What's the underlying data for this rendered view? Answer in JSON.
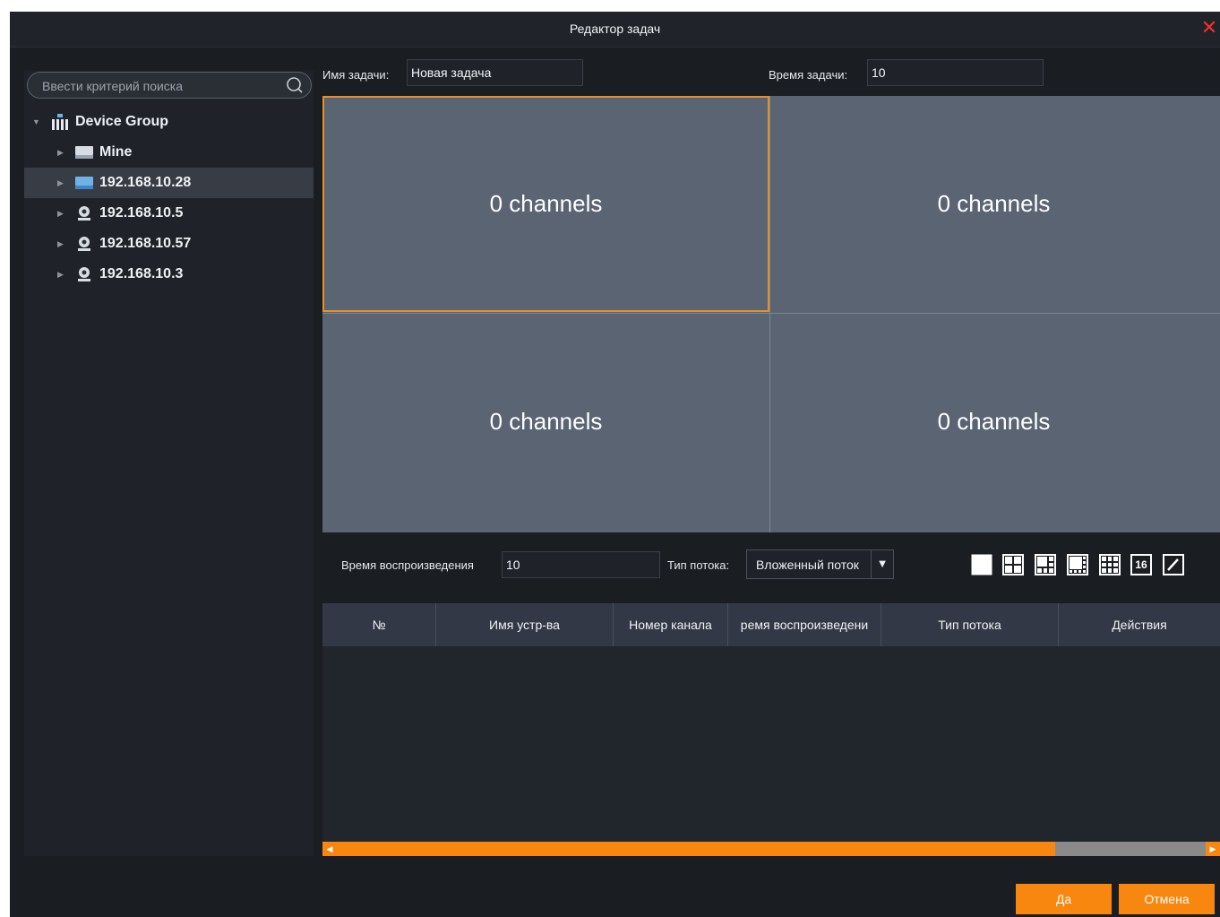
{
  "dialog": {
    "title": "Редактор задач",
    "close_icon": "close-icon"
  },
  "search": {
    "placeholder": "Ввести критерий поиска"
  },
  "tree": {
    "root": {
      "label": "Device Group",
      "icon": "device-group-icon"
    },
    "items": [
      {
        "label": "Mine",
        "icon": "nvr-icon"
      },
      {
        "label": "192.168.10.28",
        "icon": "nvr-icon",
        "selected": true
      },
      {
        "label": "192.168.10.5",
        "icon": "camera-icon"
      },
      {
        "label": "192.168.10.57",
        "icon": "camera-icon"
      },
      {
        "label": "192.168.10.3",
        "icon": "camera-icon"
      }
    ]
  },
  "task": {
    "name_label": "Имя задачи:",
    "name_value": "Новая задача",
    "time_label": "Время задачи:",
    "time_value": "10"
  },
  "grid": {
    "cells": [
      {
        "text": "0 channels",
        "active": true
      },
      {
        "text": "0 channels"
      },
      {
        "text": "0 channels"
      },
      {
        "text": "0 channels"
      }
    ]
  },
  "controls": {
    "playback_label": "Время воспроизведения",
    "playback_value": "10",
    "stream_label": "Тип потока:",
    "stream_value": "Вложенный поток",
    "layouts": [
      "1",
      "4",
      "6",
      "8",
      "9",
      "16",
      "custom"
    ],
    "layout_16_label": "16"
  },
  "table": {
    "columns": [
      "№",
      "Имя устр-ва",
      "Номер канала",
      "ремя воспроизведени",
      "Тип потока",
      "Действия"
    ],
    "rows": []
  },
  "buttons": {
    "ok": "Да",
    "cancel": "Отмена"
  },
  "colors": {
    "accent": "#f7870f",
    "active_border": "#e6902a",
    "close": "#ff2b2b",
    "cell_bg": "#5b6473"
  }
}
